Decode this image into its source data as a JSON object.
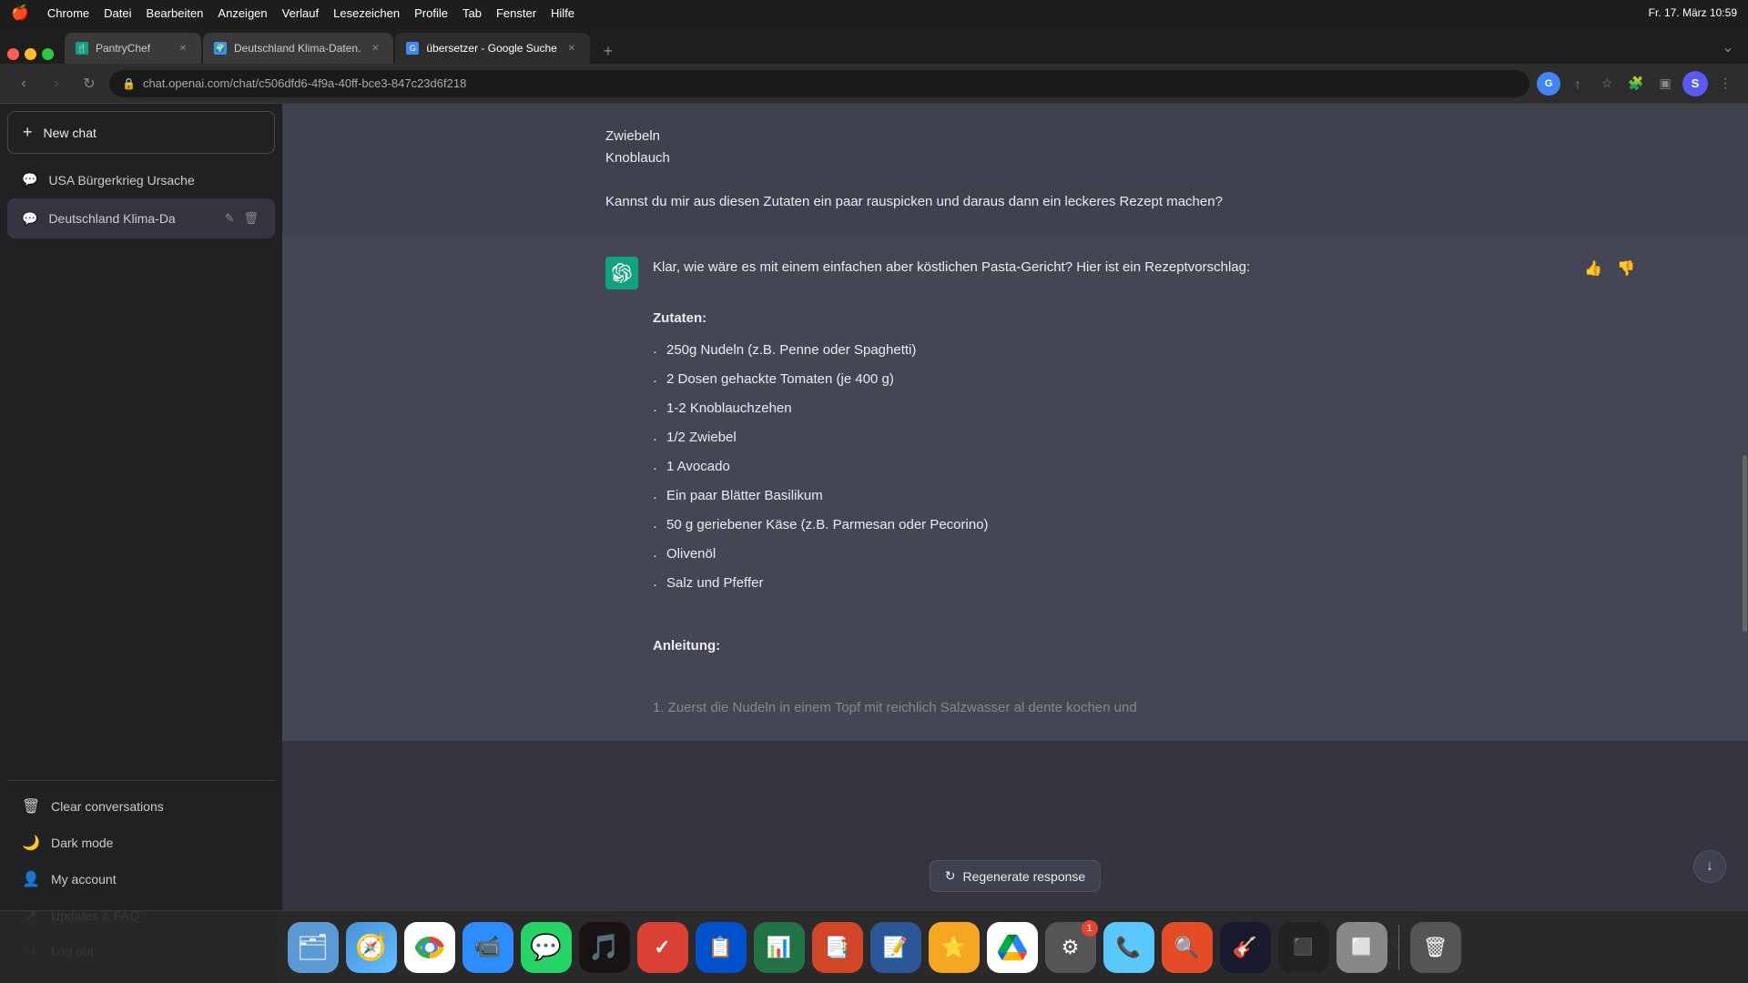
{
  "menubar": {
    "apple": "🍎",
    "items": [
      "Chrome",
      "Datei",
      "Bearbeiten",
      "Anzeigen",
      "Verlauf",
      "Lesezeichen",
      "Profile",
      "Tab",
      "Fenster",
      "Hilfe"
    ],
    "time": "Fr. 17. März  10:59"
  },
  "browser": {
    "tabs": [
      {
        "id": "pantry",
        "label": "PantryChef",
        "active": false,
        "favicon_char": "🍴"
      },
      {
        "id": "klima",
        "label": "Deutschland Klima-Daten.",
        "active": false,
        "favicon_char": "🌍"
      },
      {
        "id": "translate",
        "label": "übersetzer - Google Suche",
        "active": true,
        "favicon_char": "G"
      }
    ],
    "url": "chat.openai.com/chat/c506dfd6-4f9a-40ff-bce3-847c23d6f218"
  },
  "sidebar": {
    "new_chat_label": "New chat",
    "conversations": [
      {
        "id": "1",
        "label": "USA Bürgerkrieg Ursache",
        "active": false
      },
      {
        "id": "2",
        "label": "Deutschland Klima-Da",
        "active": true
      }
    ],
    "footer_items": [
      {
        "id": "clear",
        "icon": "🗑",
        "label": "Clear conversations"
      },
      {
        "id": "dark",
        "icon": "🌙",
        "label": "Dark mode"
      },
      {
        "id": "account",
        "icon": "👤",
        "label": "My account"
      },
      {
        "id": "updates",
        "icon": "↗",
        "label": "Updates & FAQ"
      },
      {
        "id": "logout",
        "icon": "→",
        "label": "Log out"
      }
    ]
  },
  "chat": {
    "user_message_above": "Zwiebeln\nKnoblauch\n\nKannst du mir aus diesen Zutaten ein paar rauspicken und daraus dann ein leckeres Rezept machen?",
    "user_message_line1": "Zwiebeln",
    "user_message_line2": "Knoblauch",
    "user_message_question": "Kannst du mir aus diesen Zutaten ein paar rauspicken und daraus dann ein leckeres Rezept machen?",
    "ai_intro": "Klar, wie wäre es mit einem einfachen aber köstlichen Pasta-Gericht? Hier ist ein Rezeptvorschlag:",
    "ai_zutaten_label": "Zutaten:",
    "ai_zutaten": [
      "250g Nudeln (z.B. Penne oder Spaghetti)",
      "2 Dosen gehackte Tomaten (je 400 g)",
      "1-2 Knoblauchzehen",
      "1/2 Zwiebel",
      "1 Avocado",
      "Ein paar Blätter Basilikum",
      "50 g geriebener Käse (z.B. Parmesan oder Pecorino)",
      "Olivenöl",
      "Salz und Pfeffer"
    ],
    "ai_anleitung_label": "Anleitung:",
    "ai_partial": "1.  Zuerst die Nudeln in einem Topf mit reichlich Salzwasser al dente kochen und",
    "regenerate_label": "Regenerate response",
    "input_placeholder": ""
  },
  "dock_apps": [
    {
      "id": "finder",
      "emoji": "🗂",
      "color": "#5b9bd5"
    },
    {
      "id": "safari",
      "emoji": "🧭",
      "color": "#4a90d9"
    },
    {
      "id": "chrome",
      "emoji": "🌐",
      "color": "#ea4335"
    },
    {
      "id": "zoom",
      "emoji": "📹",
      "color": "#2d8cff"
    },
    {
      "id": "whatsapp",
      "emoji": "💬",
      "color": "#25d366"
    },
    {
      "id": "spotify",
      "emoji": "🎵",
      "color": "#1db954"
    },
    {
      "id": "todoist",
      "emoji": "✓",
      "color": "#db4035"
    },
    {
      "id": "trello",
      "emoji": "📋",
      "color": "#0052cc"
    },
    {
      "id": "excel",
      "emoji": "📊",
      "color": "#217346"
    },
    {
      "id": "powerpoint",
      "emoji": "📑",
      "color": "#d04727"
    },
    {
      "id": "word",
      "emoji": "📝",
      "color": "#2b5796"
    },
    {
      "id": "notability",
      "emoji": "⭐",
      "color": "#f5a623"
    },
    {
      "id": "googledrive",
      "emoji": "△",
      "color": "#4285f4"
    },
    {
      "id": "systemprefs",
      "emoji": "⚙",
      "color": "#555",
      "badge": "1"
    },
    {
      "id": "facetime",
      "emoji": "📞",
      "color": "#5ac8fa"
    },
    {
      "id": "clipgrab",
      "emoji": "🔍",
      "color": "#e34c26"
    },
    {
      "id": "unknown1",
      "emoji": "🎸",
      "color": "#333"
    },
    {
      "id": "unknown2",
      "emoji": "⬛",
      "color": "#222"
    },
    {
      "id": "unknown3",
      "emoji": "⬜",
      "color": "#888"
    },
    {
      "id": "trash",
      "emoji": "🗑",
      "color": "#888"
    }
  ]
}
